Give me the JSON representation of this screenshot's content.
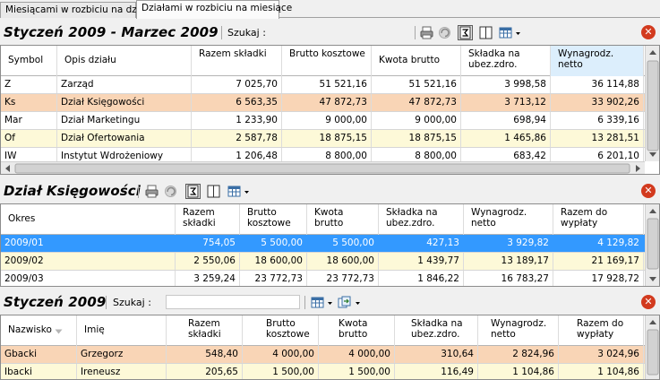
{
  "tabs": [
    {
      "label": "Miesiącami w rozbiciu na działy"
    },
    {
      "label": "Działami w rozbiciu na miesiące"
    }
  ],
  "section1": {
    "title": "Styczeń 2009 - Marzec 2009",
    "search_label": "Szukaj :",
    "columns": [
      "Symbol",
      "Opis działu",
      "Razem składki",
      "Brutto kosztowe",
      "Kwota brutto",
      "Składka na ubez.zdro.",
      "Wynagrodz. netto"
    ],
    "rows": [
      {
        "symbol": "Z",
        "opis": "Zarząd",
        "razem": "7 025,70",
        "brutto_koszt": "51 521,16",
        "kwota": "51 521,16",
        "zdro": "3 998,58",
        "netto": "36 114,88"
      },
      {
        "symbol": "Ks",
        "opis": "Dział Księgowości",
        "razem": "6 563,35",
        "brutto_koszt": "47 872,73",
        "kwota": "47 872,73",
        "zdro": "3 713,12",
        "netto": "33 902,26"
      },
      {
        "symbol": "Mar",
        "opis": "Dział Marketingu",
        "razem": "1 233,90",
        "brutto_koszt": "9 000,00",
        "kwota": "9 000,00",
        "zdro": "698,94",
        "netto": "6 339,16"
      },
      {
        "symbol": "Of",
        "opis": "Dział Ofertowania",
        "razem": "2 587,78",
        "brutto_koszt": "18 875,15",
        "kwota": "18 875,15",
        "zdro": "1 465,86",
        "netto": "13 281,51"
      },
      {
        "symbol": "IW",
        "opis": "Instytut Wdrożeniowy",
        "razem": "1 206,48",
        "brutto_koszt": "8 800,00",
        "kwota": "8 800,00",
        "zdro": "683,42",
        "netto": "6 201,10"
      }
    ]
  },
  "section2": {
    "title": "Dział Księgowości",
    "columns": [
      "Okres",
      "Razem składki",
      "Brutto kosztowe",
      "Kwota brutto",
      "Składka na ubez.zdro.",
      "Wynagrodz. netto",
      "Razem do wypłaty"
    ],
    "rows": [
      {
        "okres": "2009/01",
        "razem": "754,05",
        "brutto_koszt": "5 500,00",
        "kwota": "5 500,00",
        "zdro": "427,13",
        "netto": "3 929,82",
        "wyplata": "4 129,82"
      },
      {
        "okres": "2009/02",
        "razem": "2 550,06",
        "brutto_koszt": "18 600,00",
        "kwota": "18 600,00",
        "zdro": "1 439,77",
        "netto": "13 189,17",
        "wyplata": "21 169,17"
      },
      {
        "okres": "2009/03",
        "razem": "3 259,24",
        "brutto_koszt": "23 772,73",
        "kwota": "23 772,73",
        "zdro": "1 846,22",
        "netto": "16 783,27",
        "wyplata": "17 928,72"
      }
    ]
  },
  "section3": {
    "title": "Styczeń 2009",
    "search_label": "Szukaj :",
    "search_value": "",
    "columns": [
      "Nazwisko",
      "Imię",
      "Razem składki",
      "Brutto kosztowe",
      "Kwota brutto",
      "Składka na ubez.zdro.",
      "Wynagrodz. netto",
      "Razem do wypłaty"
    ],
    "rows": [
      {
        "nazwisko": "Gbacki",
        "imie": "Grzegorz",
        "razem": "548,40",
        "brutto_koszt": "4 000,00",
        "kwota": "4 000,00",
        "zdro": "310,64",
        "netto": "2 824,96",
        "wyplata": "3 024,96"
      },
      {
        "nazwisko": "Ibacki",
        "imie": "Ireneusz",
        "razem": "205,65",
        "brutto_koszt": "1 500,00",
        "kwota": "1 500,00",
        "zdro": "116,49",
        "netto": "1 104,86",
        "wyplata": "1 104,86"
      }
    ]
  },
  "colors": {
    "selected_row": "#3399ff",
    "highlight_row": "#f9d5b6",
    "alt_row": "#fdf9d8",
    "close_button": "#d23a1e"
  },
  "icons": [
    "printer-icon",
    "refresh-icon",
    "summary-icon",
    "columns-icon",
    "grid-options-icon",
    "chevron-down-icon",
    "close-icon",
    "export-icon",
    "sort-ascending-icon"
  ]
}
